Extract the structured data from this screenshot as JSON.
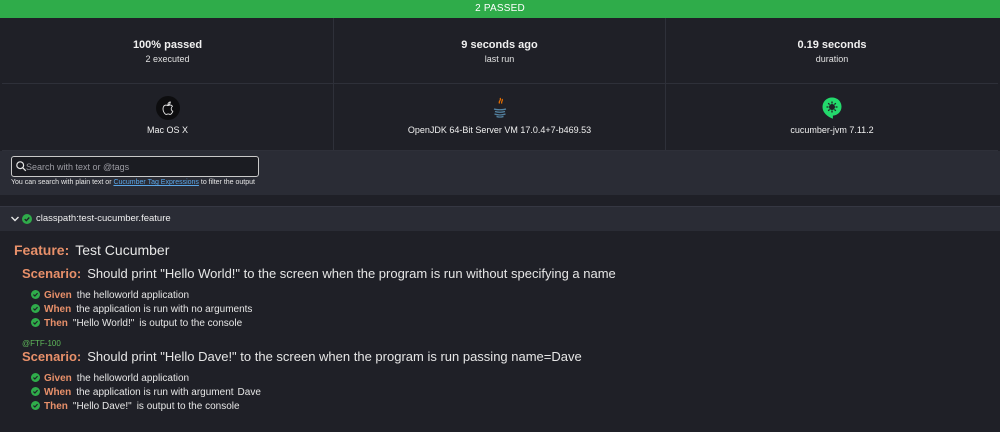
{
  "banner": {
    "text": "2 PASSED"
  },
  "stats": {
    "passed": {
      "main": "100% passed",
      "sub": "2 executed"
    },
    "last_run": {
      "main": "9 seconds ago",
      "sub": "last run"
    },
    "duration": {
      "main": "0.19 seconds",
      "sub": "duration"
    }
  },
  "environment": {
    "os": {
      "label": "Mac OS X",
      "icon": "apple-logo-icon"
    },
    "jvm": {
      "label": "OpenJDK 64-Bit Server VM 17.0.4+7-b469.53",
      "icon": "java-logo-icon"
    },
    "runner": {
      "label": "cucumber-jvm 7.11.2",
      "icon": "cucumber-logo-icon"
    }
  },
  "search": {
    "placeholder": "Search with text or @tags",
    "help_prefix": "You can search with plain text or ",
    "help_link": "Cucumber Tag Expressions",
    "help_suffix": " to filter the output"
  },
  "feature_file": {
    "path": "classpath:test-cucumber.feature"
  },
  "feature": {
    "keyword": "Feature:",
    "name": "Test Cucumber",
    "scenarios": [
      {
        "keyword": "Scenario:",
        "name": "Should print \"Hello World!\" to the screen when the program is run without specifying a name",
        "steps": [
          {
            "keyword": "Given",
            "text": "the helloworld application"
          },
          {
            "keyword": "When",
            "text": "the application is run with no arguments"
          },
          {
            "keyword": "Then",
            "arg": "\"Hello World!\"",
            "text": "is output to the console"
          }
        ]
      },
      {
        "tag": "@FTF-100",
        "keyword": "Scenario:",
        "name": "Should print \"Hello Dave!\" to the screen when the program is run passing name=Dave",
        "steps": [
          {
            "keyword": "Given",
            "text": "the helloworld application"
          },
          {
            "keyword": "When",
            "text": "the application is run with argument",
            "arg": "Dave"
          },
          {
            "keyword": "Then",
            "arg": "\"Hello Dave!\"",
            "text": "is output to the console"
          }
        ]
      }
    ]
  },
  "colors": {
    "passed": "#2fac4a",
    "keyword": "#e8906a",
    "string": "#5aa6e8",
    "tag": "#5fb85a",
    "background": "#1f2027"
  }
}
